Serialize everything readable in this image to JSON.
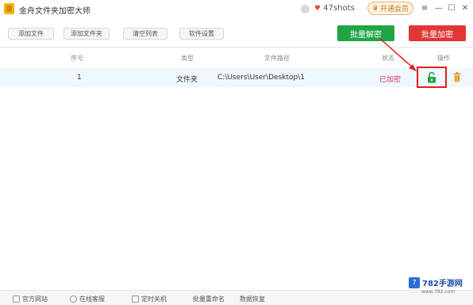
{
  "window": {
    "title": "金舟文件夹加密大师",
    "user": {
      "heart": "♥",
      "name": "47shots"
    },
    "vip_label": "开通会员",
    "controls": {
      "menu": "≡",
      "minimize": "—",
      "maximize": "☐",
      "close": "✕"
    }
  },
  "toolbar": {
    "buttons": [
      "添加文件",
      "添加文件夹",
      "清空列表",
      "软件设置"
    ],
    "batch_decrypt": "批量解密",
    "batch_encrypt": "批量加密"
  },
  "table": {
    "headers": [
      "序号",
      "类型",
      "文件路径",
      "状态",
      "操作"
    ],
    "rows": [
      {
        "index": "1",
        "type": "文件夹",
        "path": "C:\\Users\\User\\Desktop\\1",
        "status": "已加密"
      }
    ]
  },
  "bottom": {
    "items": [
      "官方网站",
      "在线客服",
      "定时关机",
      "批量重命名",
      "数据恢复"
    ]
  },
  "watermark": {
    "logo": "7",
    "text": "782手游网",
    "sub": "www.782.com"
  },
  "colors": {
    "decrypt": "#1fa446",
    "encrypt": "#e23636",
    "status": "#e0306a",
    "highlight": "#e02020"
  }
}
